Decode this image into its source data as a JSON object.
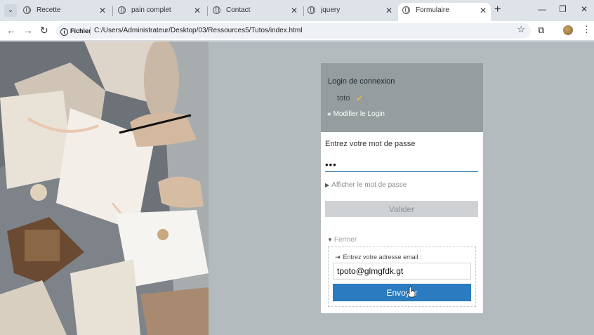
{
  "browser": {
    "tabs": [
      {
        "label": "Recette",
        "active": false
      },
      {
        "label": "pain complet",
        "active": false
      },
      {
        "label": "Contact",
        "active": false
      },
      {
        "label": "jquery",
        "active": false
      },
      {
        "label": "Formulaire",
        "active": true
      }
    ],
    "tab_close_glyph": "✕",
    "new_tab_glyph": "+",
    "address": {
      "chip_label": "Fichier",
      "url": "C:/Users/Administrateur/Desktop/03/Ressources5/Tutos/index.html"
    },
    "icons": [
      "tab-search-icon",
      "back-arrow-icon",
      "forward-arrow-icon",
      "reload-icon",
      "info-icon",
      "bookmark-star-icon",
      "extensions-icon",
      "profile-avatar-icon",
      "menu-kebab-icon",
      "minimize-icon",
      "restore-icon",
      "close-window-icon"
    ]
  },
  "login": {
    "header_title": "Login de connexion",
    "username": "toto",
    "change_login_label": "Modifier le Login",
    "password_label": "Entrez votre mot de passe",
    "password_value": "•••",
    "show_password_label": "Afficher le mot de passe",
    "submit_label": "Valider",
    "close_label": "Fermer",
    "email_label": "Entrez votre adresse email :",
    "email_value": "tpoto@glmgfdk.gt",
    "send_label": "Envoyer"
  },
  "colors": {
    "header_bg": "#959d9f",
    "page_bg": "#b3bbbe",
    "primary_button": "#2a7bbf",
    "check_color": "#e6b93c",
    "input_underline": "#2a6fa8"
  }
}
